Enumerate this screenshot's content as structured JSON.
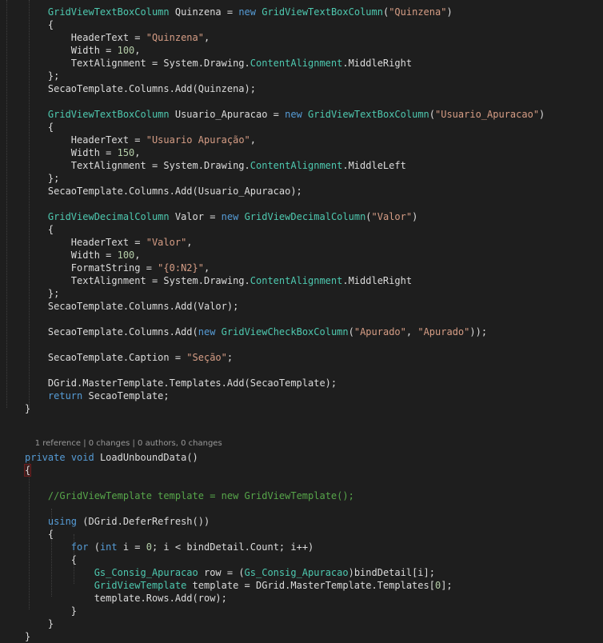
{
  "editor": {
    "language": "C#",
    "codelens": {
      "references": "1 reference",
      "changes": "0 changes",
      "authors": "0 authors, 0 changes"
    },
    "lines": [
      [
        {
          "t": "    ",
          "c": ""
        },
        {
          "t": "GridViewTextBoxColumn",
          "c": "ty"
        },
        {
          "t": " Quinzena = ",
          "c": ""
        },
        {
          "t": "new",
          "c": "kw"
        },
        {
          "t": " ",
          "c": ""
        },
        {
          "t": "GridViewTextBoxColumn",
          "c": "ty"
        },
        {
          "t": "(",
          "c": ""
        },
        {
          "t": "\"Quinzena\"",
          "c": "st"
        },
        {
          "t": ")",
          "c": ""
        }
      ],
      [
        {
          "t": "    {",
          "c": ""
        }
      ],
      [
        {
          "t": "        HeaderText = ",
          "c": ""
        },
        {
          "t": "\"Quinzena\"",
          "c": "st"
        },
        {
          "t": ",",
          "c": ""
        }
      ],
      [
        {
          "t": "        Width = ",
          "c": ""
        },
        {
          "t": "100",
          "c": "nu"
        },
        {
          "t": ",",
          "c": ""
        }
      ],
      [
        {
          "t": "        TextAlignment = System.Drawing.",
          "c": ""
        },
        {
          "t": "ContentAlignment",
          "c": "ty"
        },
        {
          "t": ".MiddleRight",
          "c": ""
        }
      ],
      [
        {
          "t": "    };",
          "c": ""
        }
      ],
      [
        {
          "t": "    SecaoTemplate.Columns.Add(Quinzena);",
          "c": ""
        }
      ],
      [
        {
          "t": "",
          "c": ""
        }
      ],
      [
        {
          "t": "    ",
          "c": ""
        },
        {
          "t": "GridViewTextBoxColumn",
          "c": "ty"
        },
        {
          "t": " Usuario_Apuracao = ",
          "c": ""
        },
        {
          "t": "new",
          "c": "kw"
        },
        {
          "t": " ",
          "c": ""
        },
        {
          "t": "GridViewTextBoxColumn",
          "c": "ty"
        },
        {
          "t": "(",
          "c": ""
        },
        {
          "t": "\"Usuario_Apuracao\"",
          "c": "st"
        },
        {
          "t": ")",
          "c": ""
        }
      ],
      [
        {
          "t": "    {",
          "c": ""
        }
      ],
      [
        {
          "t": "        HeaderText = ",
          "c": ""
        },
        {
          "t": "\"Usuario Apuração\"",
          "c": "st"
        },
        {
          "t": ",",
          "c": ""
        }
      ],
      [
        {
          "t": "        Width = ",
          "c": ""
        },
        {
          "t": "150",
          "c": "nu"
        },
        {
          "t": ",",
          "c": ""
        }
      ],
      [
        {
          "t": "        TextAlignment = System.Drawing.",
          "c": ""
        },
        {
          "t": "ContentAlignment",
          "c": "ty"
        },
        {
          "t": ".MiddleLeft",
          "c": ""
        }
      ],
      [
        {
          "t": "    };",
          "c": ""
        }
      ],
      [
        {
          "t": "    SecaoTemplate.Columns.Add(Usuario_Apuracao);",
          "c": ""
        }
      ],
      [
        {
          "t": "",
          "c": ""
        }
      ],
      [
        {
          "t": "    ",
          "c": ""
        },
        {
          "t": "GridViewDecimalColumn",
          "c": "ty"
        },
        {
          "t": " Valor = ",
          "c": ""
        },
        {
          "t": "new",
          "c": "kw"
        },
        {
          "t": " ",
          "c": ""
        },
        {
          "t": "GridViewDecimalColumn",
          "c": "ty"
        },
        {
          "t": "(",
          "c": ""
        },
        {
          "t": "\"Valor\"",
          "c": "st"
        },
        {
          "t": ")",
          "c": ""
        }
      ],
      [
        {
          "t": "    {",
          "c": ""
        }
      ],
      [
        {
          "t": "        HeaderText = ",
          "c": ""
        },
        {
          "t": "\"Valor\"",
          "c": "st"
        },
        {
          "t": ",",
          "c": ""
        }
      ],
      [
        {
          "t": "        Width = ",
          "c": ""
        },
        {
          "t": "100",
          "c": "nu"
        },
        {
          "t": ",",
          "c": ""
        }
      ],
      [
        {
          "t": "        FormatString = ",
          "c": ""
        },
        {
          "t": "\"{0:N2}\"",
          "c": "st"
        },
        {
          "t": ",",
          "c": ""
        }
      ],
      [
        {
          "t": "        TextAlignment = System.Drawing.",
          "c": ""
        },
        {
          "t": "ContentAlignment",
          "c": "ty"
        },
        {
          "t": ".MiddleRight",
          "c": ""
        }
      ],
      [
        {
          "t": "    };",
          "c": ""
        }
      ],
      [
        {
          "t": "    SecaoTemplate.Columns.Add(Valor);",
          "c": ""
        }
      ],
      [
        {
          "t": "",
          "c": ""
        }
      ],
      [
        {
          "t": "    SecaoTemplate.Columns.Add(",
          "c": ""
        },
        {
          "t": "new",
          "c": "kw"
        },
        {
          "t": " ",
          "c": ""
        },
        {
          "t": "GridViewCheckBoxColumn",
          "c": "ty"
        },
        {
          "t": "(",
          "c": ""
        },
        {
          "t": "\"Apurado\"",
          "c": "st"
        },
        {
          "t": ", ",
          "c": ""
        },
        {
          "t": "\"Apurado\"",
          "c": "st"
        },
        {
          "t": "));",
          "c": ""
        }
      ],
      [
        {
          "t": "",
          "c": ""
        }
      ],
      [
        {
          "t": "    SecaoTemplate.Caption = ",
          "c": ""
        },
        {
          "t": "\"Seção\"",
          "c": "st"
        },
        {
          "t": ";",
          "c": ""
        }
      ],
      [
        {
          "t": "",
          "c": ""
        }
      ],
      [
        {
          "t": "    DGrid.MasterTemplate.Templates.Add(SecaoTemplate);",
          "c": ""
        }
      ],
      [
        {
          "t": "    ",
          "c": ""
        },
        {
          "t": "return",
          "c": "kw"
        },
        {
          "t": " SecaoTemplate;",
          "c": ""
        }
      ],
      [
        {
          "t": "}",
          "c": ""
        }
      ],
      [
        {
          "t": "",
          "c": ""
        }
      ],
      [
        {
          "t": "private",
          "c": "kw"
        },
        {
          "t": " ",
          "c": ""
        },
        {
          "t": "void",
          "c": "kw"
        },
        {
          "t": " LoadUnboundData()",
          "c": ""
        }
      ],
      [
        {
          "t": "{",
          "c": "brace"
        }
      ],
      [
        {
          "t": "",
          "c": ""
        }
      ],
      [
        {
          "t": "    ",
          "c": ""
        },
        {
          "t": "//GridViewTemplate template = new GridViewTemplate();",
          "c": "cm"
        }
      ],
      [
        {
          "t": "",
          "c": ""
        }
      ],
      [
        {
          "t": "    ",
          "c": ""
        },
        {
          "t": "using",
          "c": "kw"
        },
        {
          "t": " (DGrid.DeferRefresh())",
          "c": ""
        }
      ],
      [
        {
          "t": "    {",
          "c": ""
        }
      ],
      [
        {
          "t": "        ",
          "c": ""
        },
        {
          "t": "for",
          "c": "kw"
        },
        {
          "t": " (",
          "c": ""
        },
        {
          "t": "int",
          "c": "kw"
        },
        {
          "t": " i = ",
          "c": ""
        },
        {
          "t": "0",
          "c": "nu"
        },
        {
          "t": "; i < bindDetail.Count; i++)",
          "c": ""
        }
      ],
      [
        {
          "t": "        {",
          "c": ""
        }
      ],
      [
        {
          "t": "            ",
          "c": ""
        },
        {
          "t": "Gs_Consig_Apuracao",
          "c": "ty"
        },
        {
          "t": " row = (",
          "c": ""
        },
        {
          "t": "Gs_Consig_Apuracao",
          "c": "ty"
        },
        {
          "t": ")bindDetail[i];",
          "c": ""
        }
      ],
      [
        {
          "t": "            ",
          "c": ""
        },
        {
          "t": "GridViewTemplate",
          "c": "ty"
        },
        {
          "t": " template = DGrid.MasterTemplate.Templates[",
          "c": ""
        },
        {
          "t": "0",
          "c": "nu"
        },
        {
          "t": "];",
          "c": ""
        }
      ],
      [
        {
          "t": "            template.Rows.Add(row);",
          "c": ""
        }
      ],
      [
        {
          "t": "        }",
          "c": ""
        }
      ],
      [
        {
          "t": "    }",
          "c": ""
        }
      ],
      [
        {
          "t": "}",
          "c": ""
        }
      ]
    ]
  }
}
